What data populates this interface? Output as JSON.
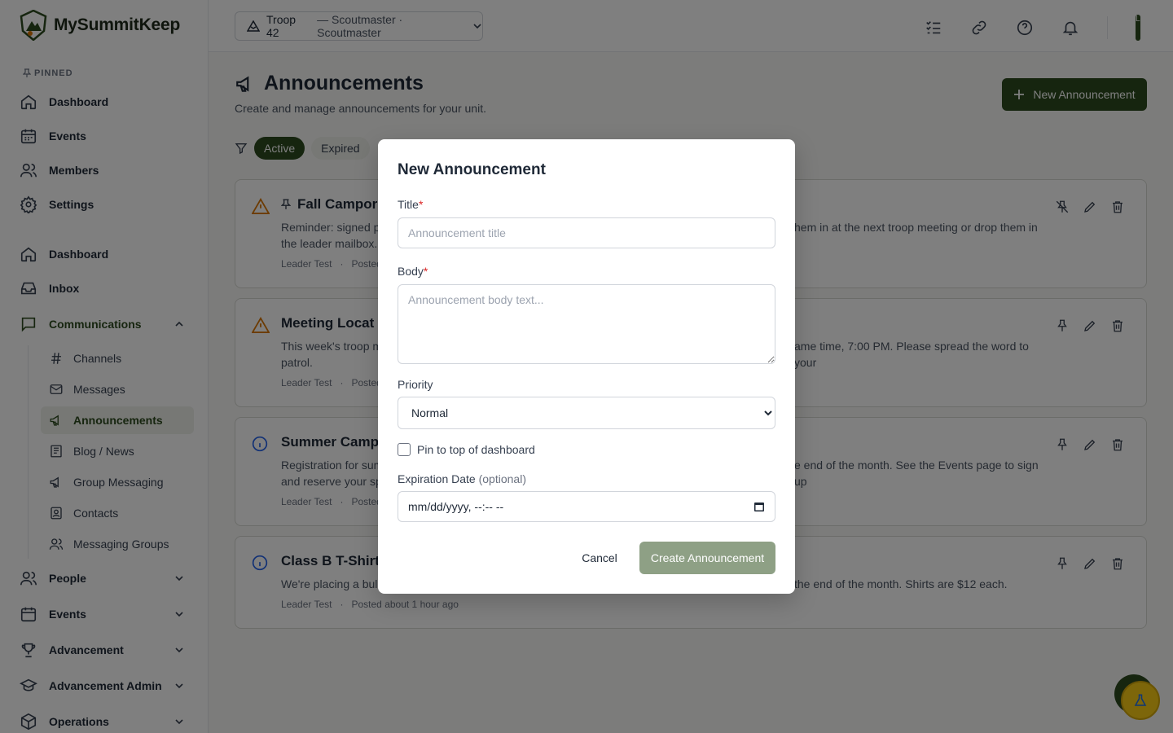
{
  "brand": {
    "name": "MySummitKeep"
  },
  "sidebar": {
    "pinned_label": "PINNED",
    "pinned": [
      {
        "label": "Dashboard",
        "icon": "home-icon"
      },
      {
        "label": "Events",
        "icon": "calendar-icon"
      },
      {
        "label": "Members",
        "icon": "users-icon"
      },
      {
        "label": "Settings",
        "icon": "gear-icon"
      }
    ],
    "main": [
      {
        "label": "Dashboard",
        "icon": "home-icon"
      },
      {
        "label": "Inbox",
        "icon": "inbox-icon"
      },
      {
        "label": "Communications",
        "icon": "chat-icon",
        "expanded": true
      }
    ],
    "sub": [
      {
        "label": "Channels",
        "icon": "hash-icon"
      },
      {
        "label": "Messages",
        "icon": "mail-icon"
      },
      {
        "label": "Announcements",
        "icon": "megaphone-icon",
        "current": true
      },
      {
        "label": "Blog / News",
        "icon": "newspaper-icon"
      },
      {
        "label": "Group Messaging",
        "icon": "megaphone-icon"
      },
      {
        "label": "Contacts",
        "icon": "contact-icon"
      },
      {
        "label": "Messaging Groups",
        "icon": "users-icon"
      }
    ],
    "groups": [
      {
        "label": "People",
        "icon": "users-icon"
      },
      {
        "label": "Events",
        "icon": "calendar-icon"
      },
      {
        "label": "Advancement",
        "icon": "trophy-icon"
      },
      {
        "label": "Advancement Admin",
        "icon": "graduation-cap-icon"
      },
      {
        "label": "Operations",
        "icon": "box-icon"
      }
    ]
  },
  "topbar": {
    "unit_name": "Troop 42",
    "unit_role": "— Scoutmaster · Scoutmaster",
    "avatar_initial": "L"
  },
  "page": {
    "title": "Announcements",
    "subtitle": "Create and manage announcements for your unit.",
    "new_button": "New Announcement",
    "filters": [
      "Active",
      "Expired"
    ]
  },
  "cards": [
    {
      "title": "Fall Campor",
      "body_left": "Reminder: signed pe",
      "body_left2": "the leader mailbox.",
      "body_right": "hem in at the next troop meeting or drop them in",
      "author": "Leader Test",
      "posted": "Posted",
      "priority": "warning",
      "pinned": true
    },
    {
      "title": "Meeting Locat",
      "body_left": "This week's troop m",
      "body_left2": "patrol.",
      "body_right": "ame time, 7:00 PM. Please spread the word to your",
      "author": "Leader Test",
      "posted": "Posted",
      "priority": "warning",
      "pinned": false
    },
    {
      "title": "Summer Camp",
      "body_left": "Registration for sum",
      "body_left2": "and reserve your sp",
      "body_right": "e end of the month. See the Events page to sign up",
      "author": "Leader Test",
      "posted": "Posted",
      "priority": "info",
      "pinned": false
    },
    {
      "title": "Class B T-Shirt",
      "body_left": "We're placing a bulk",
      "body_left2": "",
      "body_right": "the end of the month. Shirts are $12 each.",
      "author": "Leader Test",
      "posted": "Posted about 1 hour ago",
      "priority": "info",
      "pinned": false
    }
  ],
  "modal": {
    "title": "New Announcement",
    "title_label": "Title",
    "title_placeholder": "Announcement title",
    "title_value": "",
    "body_label": "Body",
    "body_placeholder": "Announcement body text...",
    "body_value": "",
    "required_mark": "*",
    "priority_label": "Priority",
    "priority_value": "Normal",
    "pin_label": "Pin to top of dashboard",
    "pin_checked": false,
    "expiration_label": "Expiration Date",
    "expiration_optional": "(optional)",
    "expiration_placeholder": "mm/dd/yyyy, --:-- --",
    "cancel_label": "Cancel",
    "create_label": "Create Announcement"
  },
  "colors": {
    "brand_green": "#2d4a1f",
    "warning": "#d97706",
    "info": "#2563eb",
    "disabled_green": "#8ea085"
  }
}
